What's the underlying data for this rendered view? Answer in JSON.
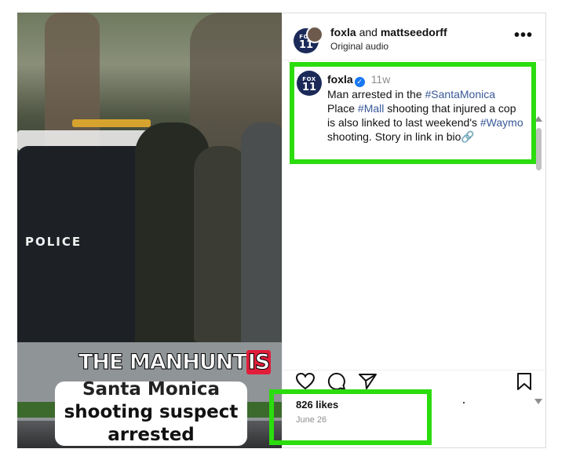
{
  "media": {
    "police_text": "POLICE",
    "headline_main": "THE MANHUNT",
    "headline_is": "IS",
    "caption_line0": "Santa Monica",
    "caption_line1": "shooting suspect",
    "caption_line2": "arrested"
  },
  "header": {
    "account1": "foxla",
    "joiner": " and ",
    "account2": "mattseedorff",
    "audio": "Original audio",
    "more": "•••",
    "avatar_top": "FOX",
    "avatar_num": "11"
  },
  "post": {
    "username": "foxla",
    "time": "11w",
    "caption_parts": [
      "Man arrested in the ",
      "#SantaMonica",
      " Place ",
      "#Mall",
      " shooting that injured a cop is also linked to last weekend's ",
      "#Waymo",
      " shooting. Story in link in bio🔗"
    ]
  },
  "footer": {
    "likes": "826 likes",
    "date": "June 26"
  },
  "colors": {
    "highlight": "#2bdc0e",
    "hashtag": "#385898",
    "verified": "#1877f2"
  }
}
